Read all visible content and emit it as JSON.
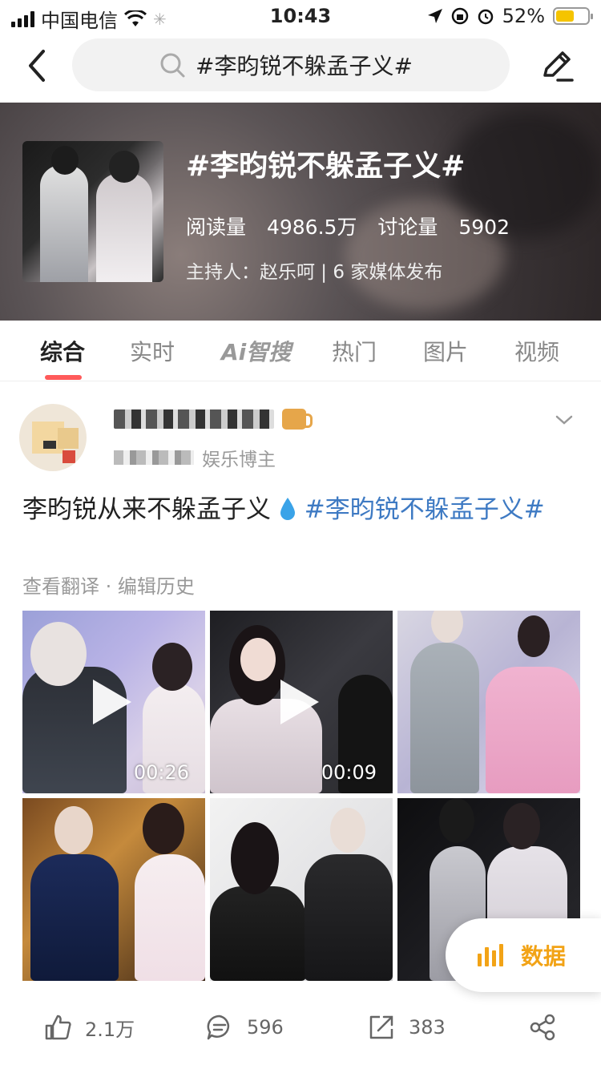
{
  "status_bar": {
    "carrier": "中国电信",
    "time": "10:43",
    "battery": "52%"
  },
  "search": {
    "query": "#李昀锐不躲孟子义#"
  },
  "topic": {
    "title": "#李昀锐不躲孟子义#",
    "read_label": "阅读量",
    "read_value": "4986.5万",
    "discuss_label": "讨论量",
    "discuss_value": "5902",
    "host_line": "主持人：赵乐呵 | 6 家媒体发布"
  },
  "tabs": [
    {
      "label": "综合",
      "active": true
    },
    {
      "label": "实时"
    },
    {
      "label": "Ai智搜"
    },
    {
      "label": "热门"
    },
    {
      "label": "图片"
    },
    {
      "label": "视频"
    }
  ],
  "post": {
    "user_badge_suffix": "娱乐博主",
    "text_main": "李昀锐从来不躲孟子义",
    "text_tag": "#李昀锐不躲孟子义#",
    "meta": "查看翻译 · 编辑历史",
    "media": [
      {
        "type": "video",
        "duration": "00:26"
      },
      {
        "type": "video",
        "duration": "00:09"
      },
      {
        "type": "image"
      },
      {
        "type": "image"
      },
      {
        "type": "image"
      },
      {
        "type": "image"
      }
    ],
    "data_button": "数据",
    "likes": "2.1万",
    "comments": "596",
    "reposts": "383"
  },
  "colors": {
    "accent_red": "#ff5a5a",
    "hashtag_blue": "#3e7ac3",
    "data_orange": "#f2a316"
  }
}
